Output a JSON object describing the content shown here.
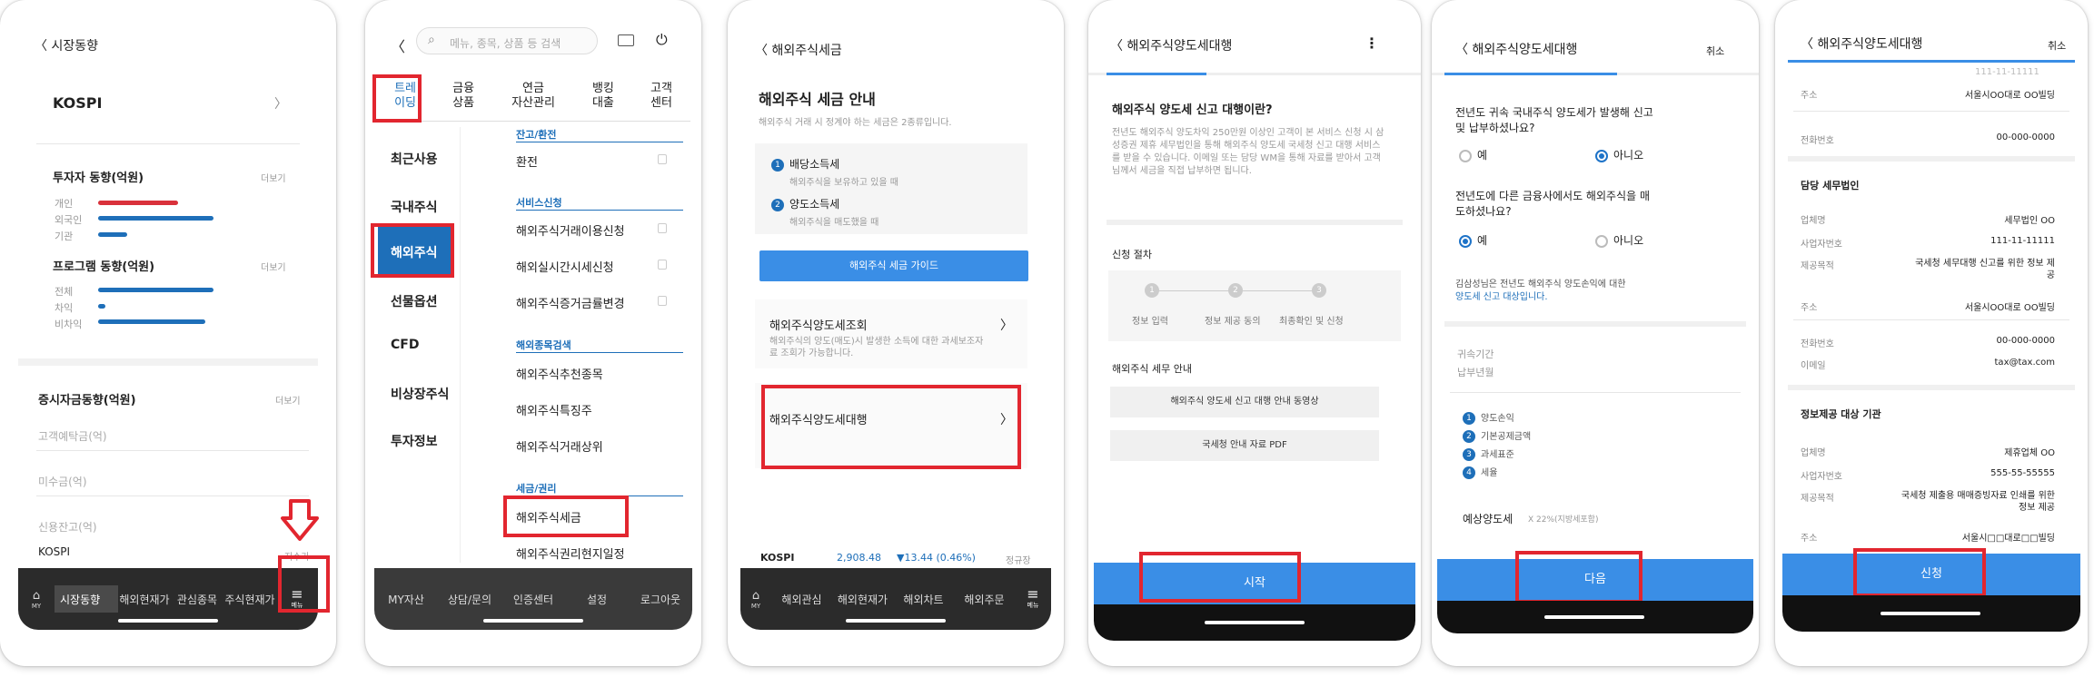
{
  "colors": {
    "accent": "#3a8ee6",
    "highlight": "#e2262f",
    "dark_bar": "#2b2b2b",
    "tab_active": "#1e6fb9"
  },
  "p1": {
    "back_title": "시장동향",
    "kospi_label": "KOSPI",
    "investor_title": "투자자 동향(억원)",
    "more1": "더보기",
    "investors": [
      "개인",
      "외국인",
      "기관"
    ],
    "program_title": "프로그램 동향(억원)",
    "more2": "더보기",
    "programs": [
      "전체",
      "차익",
      "비차익"
    ],
    "deposit_title": "증시자금동향(억원)",
    "more3": "더보기",
    "deposit_items": [
      "고객예탁금(억)",
      "미수금(억)",
      "신용잔고(억)"
    ],
    "kospi_small": "KOSPI",
    "kospi_right": "지수가",
    "nav": {
      "my": "MY",
      "tabs": [
        "시장동향",
        "해외현재가",
        "관심종목",
        "주식현재가"
      ],
      "menu": "메뉴"
    }
  },
  "p2": {
    "search_placeholder": "메뉴, 종목, 상품 등 검색",
    "top_tabs": [
      "트레\n이딩",
      "금융\n상품",
      "연금\n자산관리",
      "뱅킹\n대출",
      "고객\n센터"
    ],
    "left_menu": [
      "최근사용",
      "국내주식",
      "해외주식",
      "선물옵션",
      "CFD",
      "비상장주식",
      "투자정보"
    ],
    "sections": [
      {
        "title": "잔고/환전",
        "items": [
          "환전"
        ]
      },
      {
        "title": "서비스신청",
        "items": [
          "해외주식거래이용신청",
          "해외실시간시세신청",
          "해외주식증거금률변경"
        ]
      },
      {
        "title": "해외종목검색",
        "items": [
          "해외주식추천종목",
          "해외주식특징주",
          "해외주식거래상위"
        ]
      },
      {
        "title": "세금/권리",
        "items": [
          "해외주식세금",
          "해외주식권리현지일정"
        ]
      }
    ],
    "bottom": [
      "MY자산",
      "상담/문의",
      "인증센터",
      "설정",
      "로그아웃"
    ]
  },
  "p3": {
    "back_title": "해외주식세금",
    "heading": "해외주식 세금 안내",
    "sub": "해외주식 거래 시 정계야 하는 세금은 2종류입니다.",
    "tax1_title": "배당소득세",
    "tax1_desc": "해외주식을 보유하고 있을 때",
    "tax2_title": "양도소득세",
    "tax2_desc": "해외주식을 매도했을 때",
    "guide_btn": "해외주식 세금 가이드",
    "card1_title": "해외주식양도세조회",
    "card1_desc": "해외주식의 양도(매도)시 발생한 소득에 대한 과세보조자료 조회가 가능합니다.",
    "card2_title": "해외주식양도세대행",
    "ticker_name": "KOSPI",
    "ticker_value": "2,908.48",
    "ticker_change": "▼13.44 (0.46%)",
    "ticker_status": "정규장",
    "nav": {
      "my": "MY",
      "tabs": [
        "해외관심",
        "해외현재가",
        "해외차트",
        "해외주문"
      ],
      "menu": "메뉴"
    }
  },
  "p4": {
    "back_title": "해외주식양도세대행",
    "heading": "해외주식 양도세 신고 대행이란?",
    "desc": "전년도 해외주식 양도차익 250만원 이상인 고객이 본 서비스 신청 시 삼성증권 제휴 세무법인을 통해 해외주식 양도세 국세청 신고 대행 서비스를 받을 수 있습니다. 이메일 또는 담당 WM을 통해 자료를 받아서 고객님께서 세금을 직접 납부하면 됩니다.",
    "steps_title": "신청 절차",
    "steps": [
      "정보 입력",
      "정보 제공 동의",
      "최종확인 및 신청"
    ],
    "guide_title": "해외주식 세무 안내",
    "guide_btn1": "해외주식 양도세 신고 대행 안내 동영상",
    "guide_btn2": "국세청 안내 자료 PDF",
    "start_btn": "시작"
  },
  "p5": {
    "back_title": "해외주식양도세대행",
    "cancel": "취소",
    "q1": "전년도 귀속 국내주식 양도세가 발생해 신고 및 납부하셨나요?",
    "q1_opts": [
      "예",
      "아니오"
    ],
    "q2": "전년도에 다른 금융사에서도 해외주식을 매도하셨나요?",
    "q2_opts": [
      "예",
      "아니오"
    ],
    "note1": "김삼성님은 전년도 해외주식 양도손익에 대한",
    "note2": "양도세 신고 대상입니다.",
    "field1": "귀속기간",
    "field2": "납부년월",
    "items": [
      "양도손익",
      "기본공제금액",
      "과세표준",
      "세율"
    ],
    "expected_label": "예상양도세",
    "expected_note": "X 22%(지방세포함)",
    "next_btn": "다음"
  },
  "p6": {
    "back_title": "해외주식양도세대행",
    "cancel": "취소",
    "top_rows": [
      {
        "k": "주소",
        "v": "서울시OO대로 OO빌딩"
      },
      {
        "k": "전화번호",
        "v": "00-000-0000"
      }
    ],
    "top_partial": "111-11-11111",
    "sec1_title": "담당 세무법인",
    "sec1_rows": [
      {
        "k": "업체명",
        "v": "세무법인 OO"
      },
      {
        "k": "사업자번호",
        "v": "111-11-11111"
      },
      {
        "k": "제공목적",
        "v": "국세청 세무대행 신고를 위한 정보 제공"
      },
      {
        "k": "주소",
        "v": "서울시OO대로 OO빌딩"
      },
      {
        "k": "전화번호",
        "v": "00-000-0000"
      },
      {
        "k": "이메일",
        "v": "tax@tax.com"
      }
    ],
    "sec2_title": "정보제공 대상 기관",
    "sec2_rows": [
      {
        "k": "업체명",
        "v": "제휴업체 OO"
      },
      {
        "k": "사업자번호",
        "v": "555-55-55555"
      },
      {
        "k": "제공목적",
        "v": "국세청 제출용 매매증빙자료 인쇄를 위한 정보 제공"
      },
      {
        "k": "주소",
        "v": "서울시□□대로□□빌딩"
      }
    ],
    "apply_btn": "신청"
  }
}
